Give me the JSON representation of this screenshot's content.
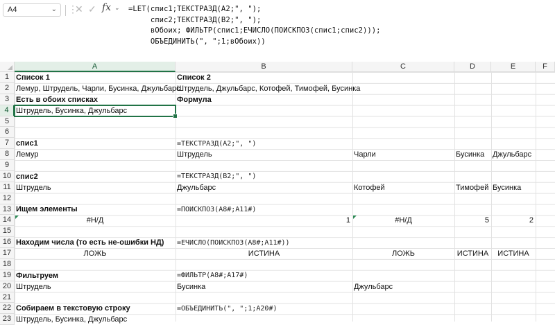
{
  "name_box": "A4",
  "formula_lines": [
    "=LET(спис1;ТЕКСТРАЗД(A2;\", \");",
    "     спис2;ТЕКСТРАЗД(B2;\", \");",
    "     вОбоих; ФИЛЬТР(спис1;ЕЧИСЛО(ПОИСКПОЗ(спис1;спис2)));",
    "     ОБЪЕДИНИТЬ(\", \";1;вОбоих))"
  ],
  "columns": [
    "A",
    "B",
    "C",
    "D",
    "E",
    "F"
  ],
  "rows": [
    "1",
    "2",
    "3",
    "4",
    "5",
    "6",
    "7",
    "8",
    "9",
    "10",
    "11",
    "12",
    "13",
    "14",
    "15",
    "16",
    "17",
    "18",
    "19",
    "20",
    "21",
    "22",
    "23"
  ],
  "cells": {
    "A1": "Список 1",
    "B1": "Список 2",
    "A2": "Лемур, Штрудель, Чарли, Бусинка, Джульбарс",
    "B2": "Штрудель, Джульбарс, Котофей, Тимофей, Бусинка",
    "A3": "Есть в обоих списках",
    "B3": "Формула",
    "A4": "Штрудель, Бусинка, Джульбарс",
    "A7": "спис1",
    "B7": "=ТЕКСТРАЗД(A2;\", \")",
    "A8": "Лемур",
    "B8": "Штрудель",
    "C8": "Чарли",
    "D8": "Бусинка",
    "E8": "Джульбарс",
    "A10": "спис2",
    "B10": "=ТЕКСТРАЗД(B2;\", \")",
    "A11": "Штрудель",
    "B11": "Джульбарс",
    "C11": "Котофей",
    "D11": "Тимофей",
    "E11": "Бусинка",
    "A13": "Ищем элементы",
    "B13": "=ПОИСКПОЗ(A8#;A11#)",
    "A14": "#Н/Д",
    "B14": "1",
    "C14": "#Н/Д",
    "D14": "5",
    "E14": "2",
    "A16": "Находим числа (то есть не-ошибки НД)",
    "B16": "=ЕЧИСЛО(ПОИСКПОЗ(A8#;A11#))",
    "A17": "ЛОЖЬ",
    "B17": "ИСТИНА",
    "C17": "ЛОЖЬ",
    "D17": "ИСТИНА",
    "E17": "ИСТИНА",
    "A19": "Фильтруем",
    "B19": "=ФИЛЬТР(A8#;A17#)",
    "A20": "Штрудель",
    "B20": "Бусинка",
    "C20": "Джульбарс",
    "A22": "Собираем в текстовую строку",
    "B22": "=ОБЪЕДИНИТЬ(\", \";1;A20#)",
    "A23": "Штрудель, Бусинка, Джульбарс"
  },
  "colors": {
    "accent": "#217346",
    "header_bg": "#f5f5f5",
    "gridline": "#e2e2e2"
  }
}
